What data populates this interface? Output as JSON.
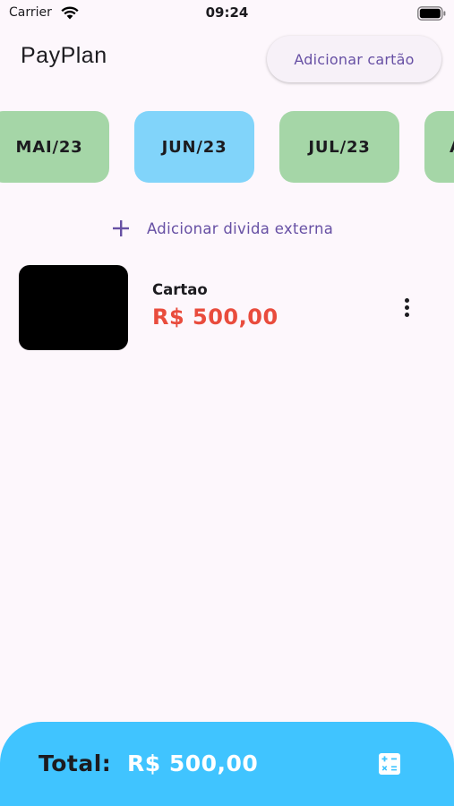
{
  "status_bar": {
    "carrier": "Carrier",
    "time": "09:24",
    "icons": [
      "wifi-icon",
      "battery-icon"
    ]
  },
  "app_bar": {
    "title": "PayPlan",
    "add_card_label": "Adicionar cartão"
  },
  "months": [
    {
      "label": "MAI/23",
      "selected": false
    },
    {
      "label": "JUN/23",
      "selected": true
    },
    {
      "label": "JUL/23",
      "selected": false
    },
    {
      "label": "A",
      "selected": false
    }
  ],
  "add_debt": {
    "label": "Adicionar divida externa",
    "icon": "plus-icon"
  },
  "cards": [
    {
      "name": "Cartao",
      "amount": "R$ 500,00",
      "icon": "more-vert-icon"
    }
  ],
  "total": {
    "label": "Total:",
    "value": "R$ 500,00",
    "icon": "calculate-icon"
  },
  "colors": {
    "background": "#fdf7fc",
    "accent": "#6750a4",
    "month_default": "#a5d6a7",
    "month_selected": "#81d4fa",
    "amount": "#e94c3d",
    "total_bar": "#40c4ff"
  }
}
